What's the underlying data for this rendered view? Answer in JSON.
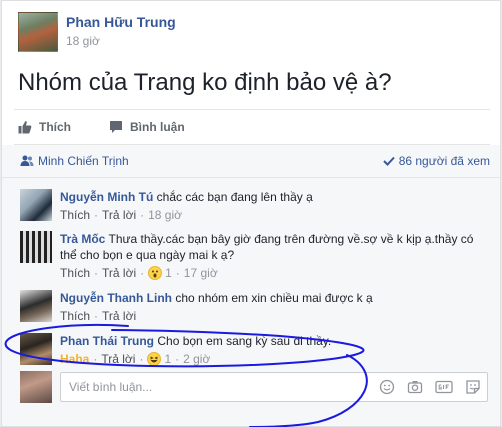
{
  "post": {
    "author": "Phan Hữu Trung",
    "time": "18 giờ",
    "text": "Nhóm của Trang ko định bảo vệ à?"
  },
  "actions": {
    "like_label": "Thích",
    "comment_label": "Bình luận"
  },
  "seen": {
    "tagged_name": "Minh Chiến Trịnh",
    "seen_count_label": "86 người đã xem"
  },
  "comments": [
    {
      "author": "Nguyễn Minh Tú",
      "text": "chắc các bạn đang lên thầy ạ",
      "like": "Thích",
      "reply": "Trả lời",
      "time": "18 giờ",
      "reaction_count": ""
    },
    {
      "author": "Trà Mốc",
      "text": "Thưa thầy.các bạn bây giờ đang trên đường về.sợ về k kịp ạ.thầy có thể cho bọn e qua ngày mai k ạ?",
      "like": "Thích",
      "reply": "Trả lời",
      "time": "17 giờ",
      "reaction_count": "1"
    },
    {
      "author": "Nguyễn Thanh Linh",
      "text": "cho nhóm em xin chiều mai được k ạ",
      "like": "Thích",
      "reply": "Trả lời",
      "time": "",
      "reaction_count": ""
    },
    {
      "author": "Phan Thái Trung",
      "text": "Cho bọn em sang kỳ sau đi thầy.",
      "like": "Haha",
      "reply": "Trả lời",
      "time": "2 giờ",
      "reaction_count": "1"
    }
  ],
  "reply_box": {
    "placeholder": "Viết bình luận..."
  },
  "colors": {
    "link_blue": "#365899",
    "scribble_blue": "#1a1ae0",
    "haha_yellow": "#f7b125"
  }
}
